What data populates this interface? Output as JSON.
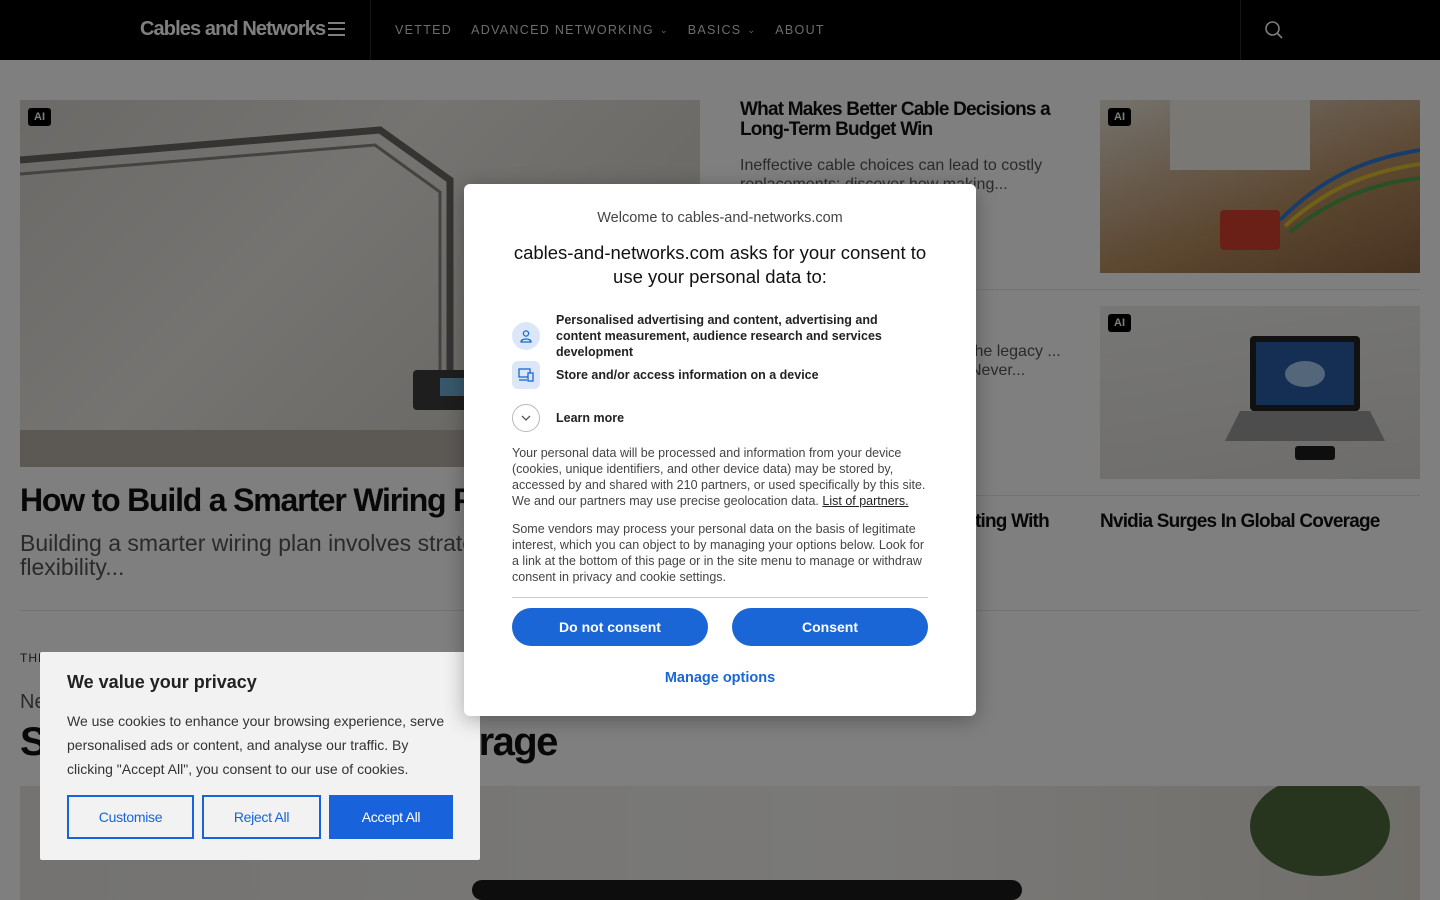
{
  "header": {
    "logo": "Cables and Networks",
    "nav": [
      {
        "label": "VETTED",
        "dropdown": false
      },
      {
        "label": "ADVANCED NETWORKING",
        "dropdown": true
      },
      {
        "label": "BASICS",
        "dropdown": true
      },
      {
        "label": "ABOUT",
        "dropdown": false
      }
    ],
    "icons": [
      "menu-icon",
      "search-icon"
    ]
  },
  "hero": {
    "badge": "AI",
    "title": "How to Build a Smarter Wiring Plan",
    "description": "Building a smarter wiring plan involves strategies for stability and flexibility..."
  },
  "cards": [
    {
      "title": "What Makes Better Cable Decisions a Long-Term Budget Win",
      "description": "Ineffective cable choices can lead to costly replacements; discover how making...",
      "badge": "AI"
    },
    {
      "title": "",
      "description": "the legacy ... Never...",
      "badge": "AI"
    },
    {
      "title_fragment": "ting With"
    },
    {
      "title": "Nvidia Surges In Global Coverage"
    }
  ],
  "section": {
    "label": "THE",
    "sub": "Ne",
    "title_left": "S",
    "title_right": "erage"
  },
  "cookie_notice": {
    "title": "We value your privacy",
    "text": "We use cookies to enhance your browsing experience, serve personalised ads or content, and analyse our traffic. By clicking \"Accept All\", you consent to our use of cookies.",
    "customise": "Customise",
    "reject": "Reject All",
    "accept": "Accept All"
  },
  "consent_dialog": {
    "welcome": "Welcome to cables-and-networks.com",
    "heading": "cables-and-networks.com asks for your consent to use your personal data to:",
    "purposes": [
      {
        "icon": "person-icon",
        "text": "Personalised advertising and content, advertising and content measurement, audience research and services development"
      },
      {
        "icon": "device-icon",
        "text": "Store and/or access information on a device"
      }
    ],
    "learn_more": "Learn more",
    "para1": "Your personal data will be processed and information from your device (cookies, unique identifiers, and other device data) may be stored by, accessed by and shared with 210 partners, or used specifically by this site. We and our partners may use precise geolocation data.",
    "partners_link": "List of partners.",
    "para2": "Some vendors may process your personal data on the basis of legitimate interest, which you can object to by managing your options below. Look for a link at the bottom of this page or in the site menu to manage or withdraw consent in privacy and cookie settings.",
    "do_not_consent": "Do not consent",
    "consent": "Consent",
    "manage_options": "Manage options"
  },
  "colors": {
    "accent": "#1a66d6",
    "cookie_accent": "#1863dc"
  }
}
